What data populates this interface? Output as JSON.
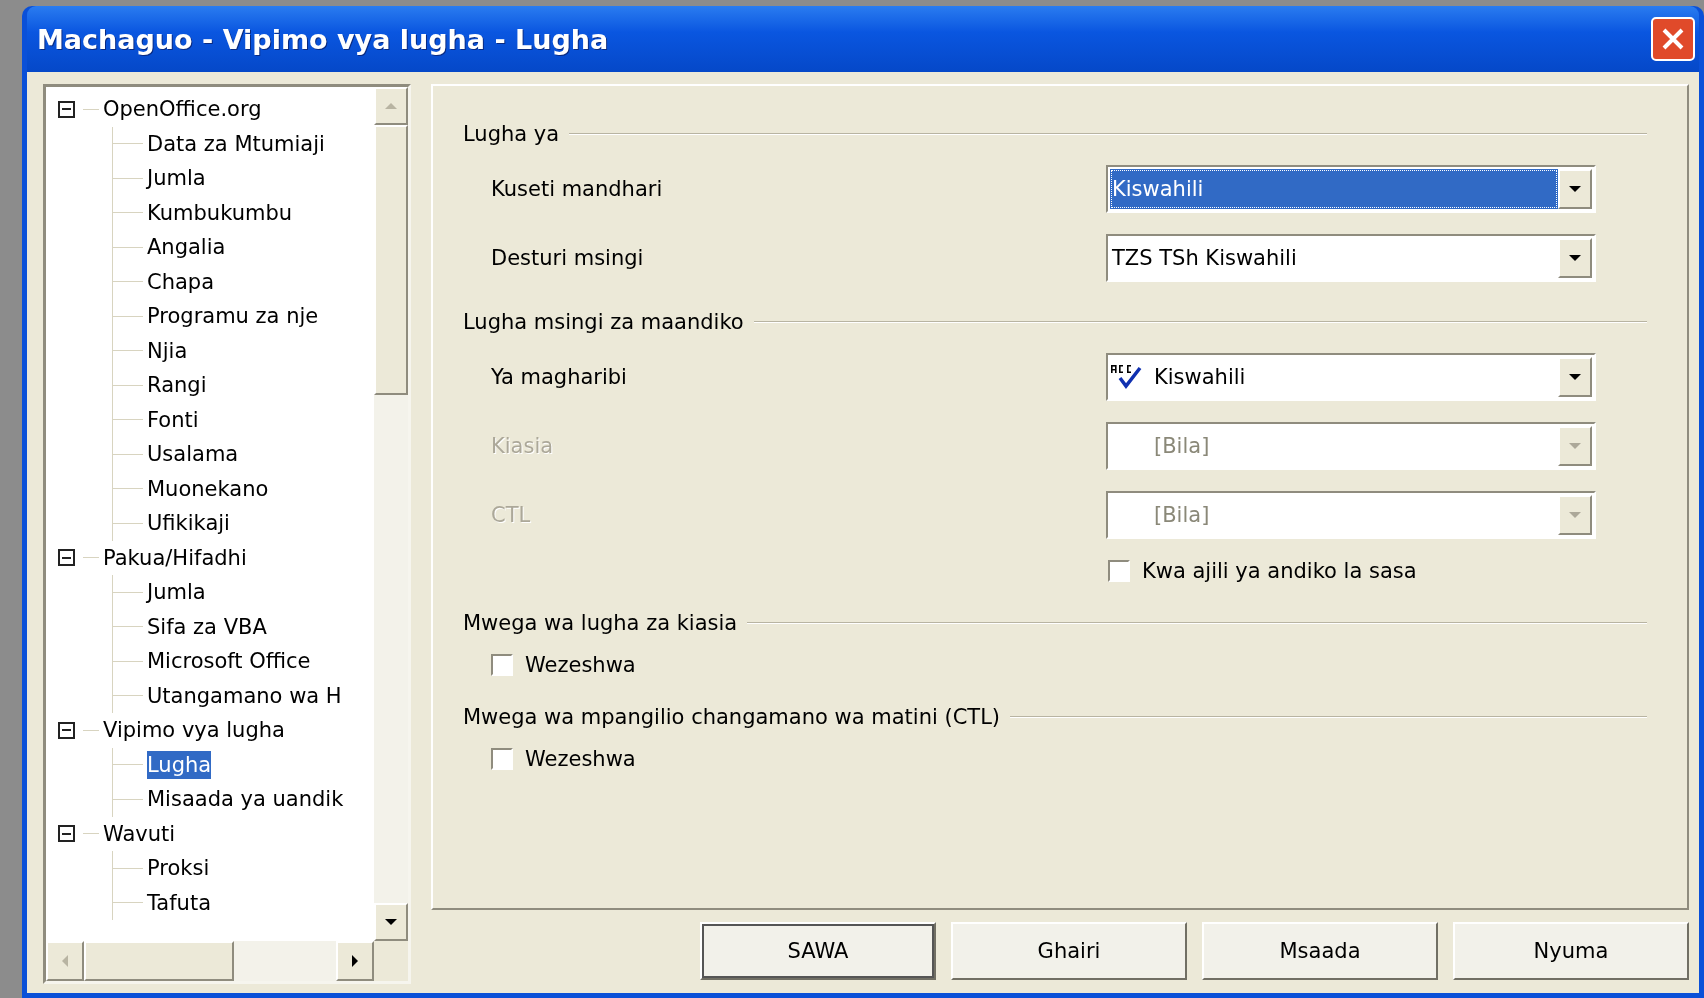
{
  "window": {
    "title": "Machaguo - Vipimo vya lugha - Lugha"
  },
  "tree": {
    "items": [
      {
        "label": "OpenOffice.org",
        "expanded": true,
        "selected": false,
        "children": [
          {
            "label": "Data za Mtumiaji",
            "selected": false
          },
          {
            "label": "Jumla",
            "selected": false
          },
          {
            "label": "Kumbukumbu",
            "selected": false
          },
          {
            "label": "Angalia",
            "selected": false
          },
          {
            "label": "Chapa",
            "selected": false
          },
          {
            "label": "Programu za nje",
            "selected": false
          },
          {
            "label": "Njia",
            "selected": false
          },
          {
            "label": "Rangi",
            "selected": false
          },
          {
            "label": "Fonti",
            "selected": false
          },
          {
            "label": "Usalama",
            "selected": false
          },
          {
            "label": "Muonekano",
            "selected": false
          },
          {
            "label": "Ufikikaji",
            "selected": false
          }
        ]
      },
      {
        "label": "Pakua/Hifadhi",
        "expanded": true,
        "selected": false,
        "children": [
          {
            "label": "Jumla",
            "selected": false
          },
          {
            "label": "Sifa za VBA",
            "selected": false
          },
          {
            "label": "Microsoft Office",
            "selected": false
          },
          {
            "label": "Utangamano wa H",
            "selected": false
          }
        ]
      },
      {
        "label": "Vipimo vya lugha",
        "expanded": true,
        "selected": false,
        "children": [
          {
            "label": "Lugha",
            "selected": true
          },
          {
            "label": "Misaada ya uandik",
            "selected": false
          }
        ]
      },
      {
        "label": "Wavuti",
        "expanded": true,
        "selected": false,
        "children": [
          {
            "label": "Proksi",
            "selected": false
          },
          {
            "label": "Tafuta",
            "selected": false
          }
        ]
      }
    ]
  },
  "sections": [
    {
      "title": "Lugha ya",
      "rows": [
        {
          "kind": "combo",
          "label": "Kuseti mandhari",
          "value": "Kiswahili",
          "disabled": false,
          "focused": true
        },
        {
          "kind": "combo",
          "label": "Desturi msingi",
          "value": "TZS  TSh  Kiswahili",
          "disabled": false,
          "focused": false
        }
      ]
    },
    {
      "title": "Lugha msingi za maandiko",
      "rows": [
        {
          "kind": "combo",
          "label": "Ya magharibi",
          "value": "Kiswahili",
          "disabled": false,
          "focused": false,
          "spellcheck": true
        },
        {
          "kind": "combo",
          "label": "Kiasia",
          "value": "[Bila]",
          "disabled": true,
          "focused": false,
          "spellcheck": false
        },
        {
          "kind": "combo",
          "label": "CTL",
          "value": "[Bila]",
          "disabled": true,
          "focused": false,
          "spellcheck": false
        },
        {
          "kind": "checkbox",
          "label": "Kwa ajili ya andiko la sasa",
          "checked": false
        }
      ]
    },
    {
      "title": "Mwega wa lugha za kiasia",
      "rows": [
        {
          "kind": "check",
          "label": "Wezeshwa",
          "checked": false
        }
      ]
    },
    {
      "title": "Mwega wa mpangilio changamano wa matini (CTL)",
      "rows": [
        {
          "kind": "check",
          "label": "Wezeshwa",
          "checked": false
        }
      ]
    }
  ],
  "buttons": [
    {
      "label": "SAWA",
      "default": true
    },
    {
      "label": "Ghairi",
      "default": false
    },
    {
      "label": "Msaada",
      "default": false
    },
    {
      "label": "Nyuma",
      "default": false
    }
  ]
}
